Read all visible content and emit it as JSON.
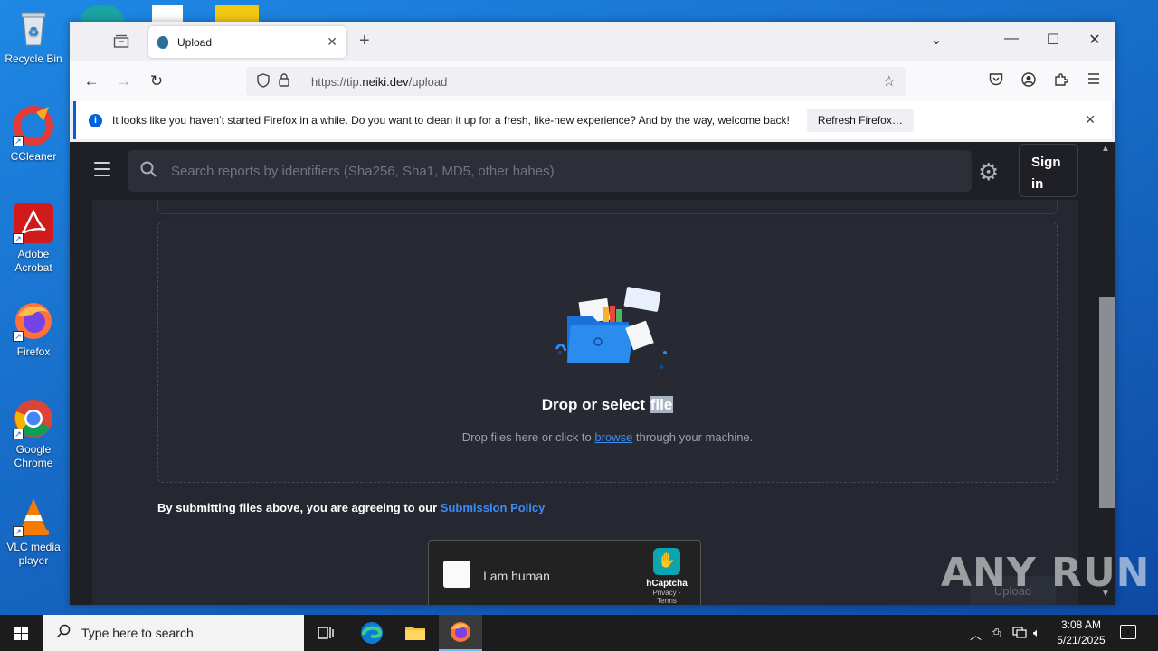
{
  "desktop": {
    "icons": [
      {
        "label": "Recycle Bin"
      },
      {
        "label": "CCleaner"
      },
      {
        "label": "Adobe Acrobat"
      },
      {
        "label": "Firefox"
      },
      {
        "label": "Google Chrome"
      },
      {
        "label": "VLC media player"
      }
    ]
  },
  "browser": {
    "tab": {
      "title": "Upload",
      "close": "✕"
    },
    "new_tab": "+",
    "window_controls": {
      "minimize": "—",
      "maximize": "☐",
      "close": "✕",
      "list_all_tabs": "⌄"
    },
    "nav": {
      "back": "←",
      "forward": "→",
      "reload": "↻"
    },
    "url": {
      "prefix": "https://tip.",
      "domain": "neiki.dev",
      "path": "/upload"
    },
    "notification": {
      "message": "It looks like you haven’t started Firefox in a while. Do you want to clean it up for a fresh, like-new experience? And by the way, welcome back!",
      "button": "Refresh Firefox…"
    }
  },
  "page": {
    "search": {
      "placeholder": "Search reports by identifiers (Sha256, Sha1, MD5, other hahes)"
    },
    "signin": "Sign in",
    "dropzone": {
      "title_prefix": "Drop or select ",
      "title_highlight": "file",
      "sub_prefix": "Drop files here or click to ",
      "sub_link": "browse",
      "sub_suffix": " through your machine."
    },
    "policy": {
      "prefix": "By submitting files above, you are agreeing to our ",
      "link": "Submission Policy"
    },
    "captcha": {
      "label": "I am human",
      "brand": "hCaptcha",
      "terms": "Privacy - Terms"
    },
    "upload_button": "Upload"
  },
  "watermark": "ANY RUN",
  "taskbar": {
    "search_placeholder": "Type here to search",
    "time": "3:08 AM",
    "date": "5/21/2025"
  },
  "colors": {
    "accent": "#3d8bf2",
    "page_bg": "#1e2025",
    "panel_bg": "#252830"
  }
}
